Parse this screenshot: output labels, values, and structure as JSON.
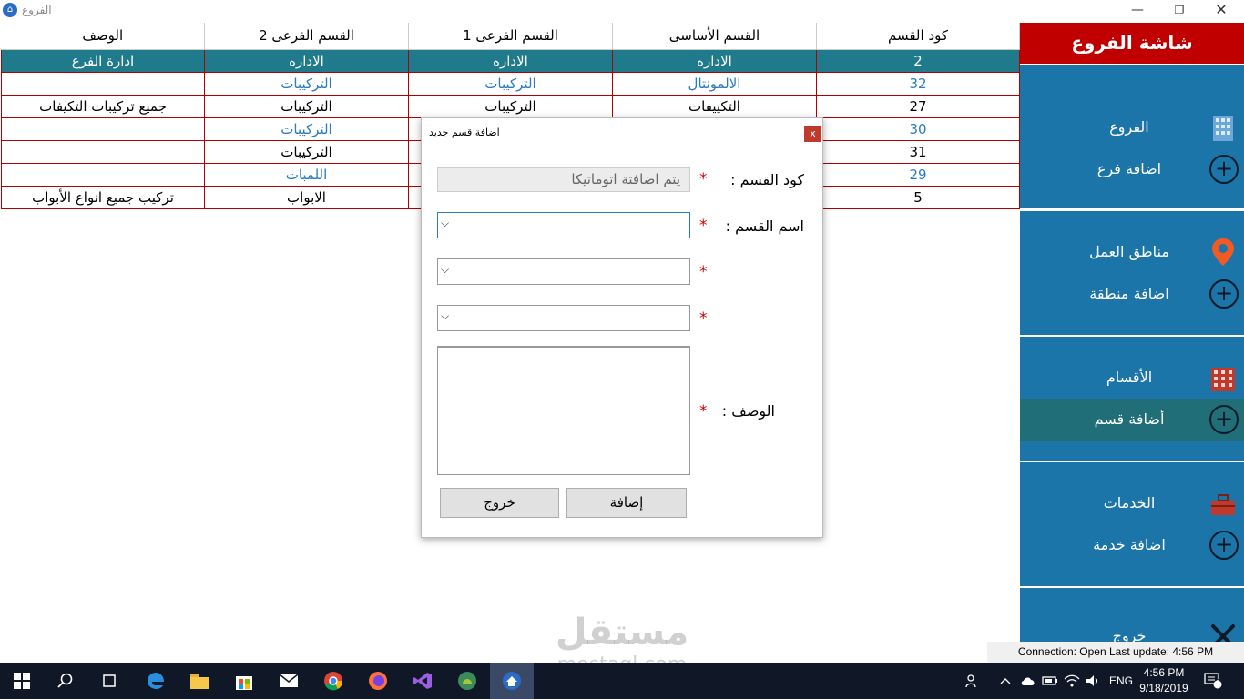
{
  "window": {
    "title": "الفروع",
    "min": "—",
    "max": "❐",
    "close": "✕"
  },
  "grid": {
    "headers": [
      "كود القسم",
      "القسم الأساسى",
      "القسم الفرعى 1",
      "القسم الفرعى 2",
      "الوصف"
    ],
    "rows": [
      [
        "2",
        "الاداره",
        "الاداره",
        "الاداره",
        "ادارة الفرع"
      ],
      [
        "32",
        "الالمونتال",
        "التركيبات",
        "التركيبات",
        ""
      ],
      [
        "27",
        "التكييفات",
        "التركيبات",
        "التركيبات",
        "جميع تركيبات التكيفات"
      ],
      [
        "30",
        "",
        "",
        "التركيبات",
        ""
      ],
      [
        "31",
        "",
        "",
        "التركيبات",
        ""
      ],
      [
        "29",
        "",
        "",
        "اللمبات",
        ""
      ],
      [
        "5",
        "",
        "",
        "الابواب",
        "تركيب جميع انواع الأبواب"
      ]
    ]
  },
  "sidebar": {
    "header": "شاشة الفروع",
    "items": [
      {
        "label": "الفروع",
        "kind": "building-icon"
      },
      {
        "label": "اضافة فرع",
        "kind": "plus-icon"
      },
      {
        "label": "مناطق العمل",
        "kind": "map-pin-icon"
      },
      {
        "label": "اضافة منطقة",
        "kind": "plus-icon"
      },
      {
        "label": "الأقسام",
        "kind": "building-red-icon"
      },
      {
        "label": "أضافة قسم",
        "kind": "plus-icon"
      },
      {
        "label": "الخدمات",
        "kind": "toolbox-icon"
      },
      {
        "label": "اضافة خدمة",
        "kind": "plus-icon"
      },
      {
        "label": "خروج",
        "kind": "exit-icon"
      }
    ],
    "plus_glyph": "+"
  },
  "status": {
    "connection": "Connection: Open Last update: 4:56 PM"
  },
  "dialog": {
    "title": "اضافة قسم جديد",
    "close": "x",
    "code_label": "كود القسم :",
    "code_value": "يتم اضافتة اتوماتيكا",
    "name_label": "اسم القسم :",
    "desc_label": "الوصف :",
    "required_mark": "*",
    "add_button": "إضافة",
    "exit_button": "خروج"
  },
  "taskbar": {
    "language": "ENG",
    "time": "4:56 PM",
    "date": "9/18/2019",
    "notifications": "1"
  },
  "watermark": {
    "arabic": "مستقل",
    "latin": "mostaql.com"
  },
  "colors": {
    "accent": "#1b75a8",
    "header_red": "#c00000",
    "selected_row": "#1f7a8c",
    "link": "#2a7bbf"
  }
}
